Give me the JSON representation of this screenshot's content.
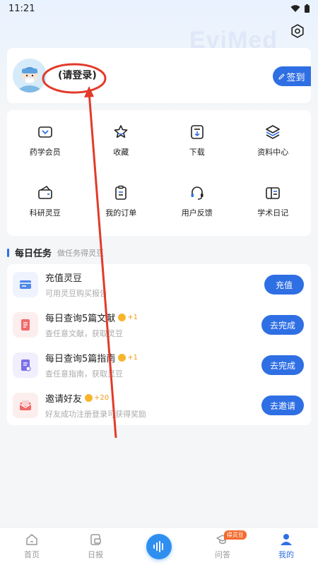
{
  "status": {
    "time": "11:21"
  },
  "watermark": "EviMed",
  "profile": {
    "login_text": "(请登录)",
    "signin_label": "签到"
  },
  "grid": [
    {
      "label": "药学会员",
      "icon": "vip-icon"
    },
    {
      "label": "收藏",
      "icon": "star-icon"
    },
    {
      "label": "下载",
      "icon": "download-icon"
    },
    {
      "label": "资料中心",
      "icon": "layers-icon"
    },
    {
      "label": "科研灵豆",
      "icon": "wallet-icon"
    },
    {
      "label": "我的订单",
      "icon": "order-icon"
    },
    {
      "label": "用户反馈",
      "icon": "headset-icon"
    },
    {
      "label": "学术日记",
      "icon": "diary-icon"
    }
  ],
  "tasks_header": {
    "title": "每日任务",
    "subtitle": "做任务得灵豆"
  },
  "tasks": [
    {
      "name": "充值灵豆",
      "reward": "",
      "desc": "可用灵豆购买报告",
      "button": "充值"
    },
    {
      "name": "每日查询5篇文献",
      "reward": "+1",
      "desc": "查任意文献，获取灵豆",
      "button": "去完成"
    },
    {
      "name": "每日查询5篇指南",
      "reward": "+1",
      "desc": "查任意指南，获取灵豆",
      "button": "去完成"
    },
    {
      "name": "邀请好友",
      "reward": "+20",
      "desc": "好友成功注册登录可获得奖励",
      "button": "去邀请"
    }
  ],
  "tabbar": {
    "items": [
      {
        "label": "首页",
        "icon": "home-icon"
      },
      {
        "label": "日报",
        "icon": "daily-icon"
      },
      {
        "label": "",
        "icon": "voice-icon"
      },
      {
        "label": "问答",
        "icon": "qa-icon",
        "badge": "得灵豆"
      },
      {
        "label": "我的",
        "icon": "user-icon",
        "active": true
      }
    ]
  },
  "colors": {
    "accent": "#2f6fe4",
    "annotation": "#e23b2a",
    "reward": "#f09a1a"
  }
}
